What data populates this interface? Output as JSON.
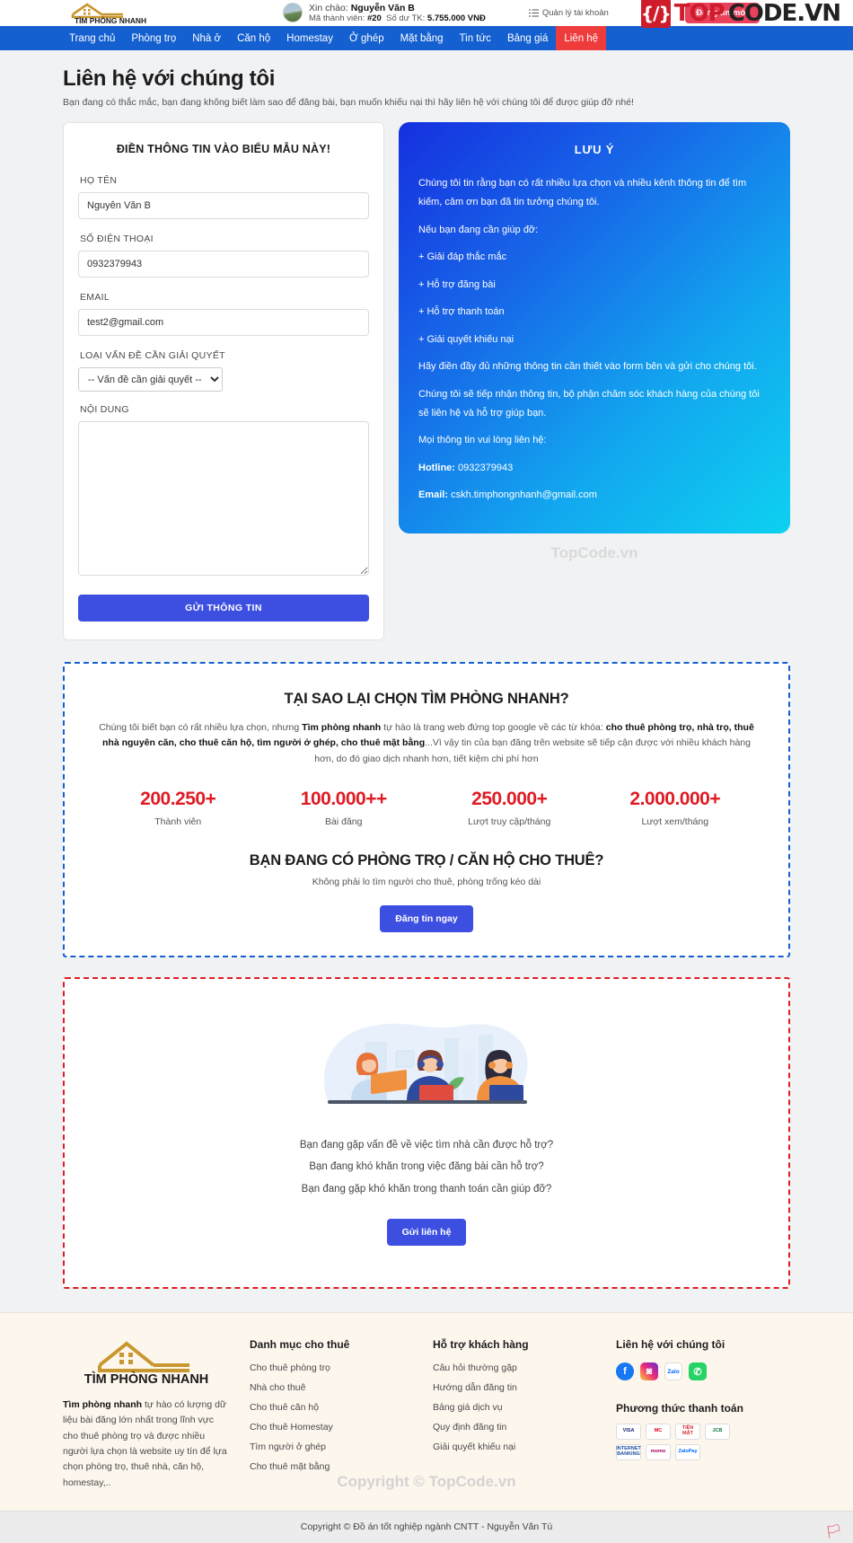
{
  "header": {
    "logo_text": "TÌM PHÒNG NHANH",
    "greeting_label": "Xin chào:",
    "user_name": "Nguyễn Văn B",
    "member_label": "Mã thành viên:",
    "member_id": "#20",
    "balance_label": "Số dư TK:",
    "balance_value": "5.755.000 VNĐ",
    "account_link": "Quản lý tài khoản",
    "account_icon": "list-settings-icon",
    "bell_icon": "notification-bell-icon",
    "post_button": "Đăng tin mới",
    "watermark_badge": "{/}",
    "watermark_top": "TOP",
    "watermark_rest": "CODE.VN"
  },
  "nav": {
    "items": [
      {
        "label": "Trang chủ",
        "active": false
      },
      {
        "label": "Phòng trọ",
        "active": false
      },
      {
        "label": "Nhà ở",
        "active": false
      },
      {
        "label": "Căn hộ",
        "active": false
      },
      {
        "label": "Homestay",
        "active": false
      },
      {
        "label": "Ở ghép",
        "active": false
      },
      {
        "label": "Mặt bằng",
        "active": false
      },
      {
        "label": "Tin tức",
        "active": false
      },
      {
        "label": "Bảng giá",
        "active": false
      },
      {
        "label": "Liên hệ",
        "active": true
      }
    ]
  },
  "page": {
    "title": "Liên hệ với chúng tôi",
    "subtitle": "Bạn đang có thắc mắc, bạn đang không biết làm sao để đăng bài, bạn muốn khiếu nại thì hãy liên hệ với chúng tôi để được giúp đỡ nhé!"
  },
  "form": {
    "heading": "ĐIỀN THÔNG TIN VÀO BIỂU MẪU NÀY!",
    "name_label": "HỌ TÊN",
    "name_value": "Nguyễn Văn B",
    "phone_label": "SỐ ĐIỆN THOẠI",
    "phone_value": "0932379943",
    "email_label": "EMAIL",
    "email_value": "test2@gmail.com",
    "issue_label": "LOẠI VẤN ĐỀ CẦN GIẢI QUYẾT",
    "issue_selected": "-- Vấn đề cần giải quyết --",
    "issue_options": [
      "-- Vấn đề cần giải quyết --"
    ],
    "content_label": "NỘI DUNG",
    "content_value": "",
    "content_placeholder": "",
    "submit_label": "GỬI THÔNG TIN"
  },
  "note": {
    "heading": "LƯU Ý",
    "paragraphs": [
      "Chúng tôi tin rằng bạn có rất nhiều lựa chọn và nhiều kênh thông tin để tìm kiếm, cảm ơn bạn đã tin tưởng chúng tôi.",
      "Nếu bạn đang cần giúp đỡ:",
      "+ Giải đáp thắc mắc",
      "+ Hỗ trợ đăng bài",
      "+ Hỗ trợ thanh toán",
      "+ Giải quyết khiếu nại",
      "Hãy điền đầy đủ những thông tin cần thiết vào form bên và gửi cho chúng tôi.",
      "Chúng tôi sẽ tiếp nhận thông tin, bộ phận chăm sóc khách hàng của chúng tôi sẽ liên hệ và hỗ trợ giúp bạn.",
      "Mọi thông tin vui lòng liên hệ:"
    ],
    "hotline_label": "Hotline:",
    "hotline_value": "0932379943",
    "email_label": "Email:",
    "email_value": "cskh.timphongnhanh@gmail.com",
    "watermark": "TopCode.vn"
  },
  "why": {
    "heading": "TẠI SAO LẠI CHỌN TÌM PHÒNG NHANH?",
    "desc_part1": "Chúng tôi biết bạn có rất nhiều lựa chọn, nhưng ",
    "desc_brand": "Tìm phòng nhanh",
    "desc_part2": " tự hào là trang web đứng top google về các từ khóa: ",
    "desc_keywords": "cho thuê phòng trọ, nhà trọ, thuê nhà nguyên căn, cho thuê căn hộ, tìm người ở ghép, cho thuê mặt bằng",
    "desc_part3": "...Vì vậy tin của bạn đăng trên website sẽ tiếp cận được với nhiều khách hàng hơn, do đó giao dịch nhanh hơn, tiết kiệm chi phí hơn",
    "stats": [
      {
        "value": "200.250+",
        "label": "Thành viên"
      },
      {
        "value": "100.000++",
        "label": "Bài đăng"
      },
      {
        "value": "250.000+",
        "label": "Lượt truy cập/tháng"
      },
      {
        "value": "2.000.000+",
        "label": "Lượt xem/tháng"
      }
    ],
    "cta_heading": "BẠN ĐANG CÓ PHÒNG TRỌ / CĂN HỘ CHO THUÊ?",
    "cta_sub": "Không phải lo tìm người cho thuê, phòng trống kéo dài",
    "cta_button": "Đăng tin ngay"
  },
  "support": {
    "illustration": "customer-support-team-illustration",
    "lines": [
      "Bạn đang gặp vấn đề về việc tìm nhà cần được hỗ trợ?",
      "Bạn đang khó khăn trong việc đăng bài cần hỗ trợ?",
      "Bạn đang gặp khó khăn trong thanh toán cần giúp đỡ?"
    ],
    "button": "Gửi liên hệ"
  },
  "footer": {
    "logo_text": "TÌM PHÒNG NHANH",
    "about_brand": "Tìm phòng nhanh",
    "about_text": " tự hào có lượng dữ liệu bài đăng lớn nhất trong lĩnh vực cho thuê phòng trọ và được nhiều người lựa chọn là website uy tín để lựa chọn phòng trọ, thuê nhà, căn hộ, homestay,..",
    "col_rent_title": "Danh mục cho thuê",
    "col_rent_items": [
      "Cho thuê phòng trọ",
      "Nhà cho thuê",
      "Cho thuê căn hộ",
      "Cho thuê Homestay",
      "Tìm người ở ghép",
      "Cho thuê mặt bằng"
    ],
    "col_support_title": "Hỗ trợ khách hàng",
    "col_support_items": [
      "Câu hỏi thường gặp",
      "Hướng dẫn đăng tin",
      "Bảng giá dịch vụ",
      "Quy định đăng tin",
      "Giải quyết khiếu nại"
    ],
    "col_contact_title": "Liên hệ với chúng tôi",
    "socials": [
      {
        "name": "facebook-icon",
        "glyph": "f"
      },
      {
        "name": "instagram-icon",
        "glyph": "◙"
      },
      {
        "name": "zalo-icon",
        "glyph": "Zalo"
      },
      {
        "name": "phone-icon",
        "glyph": "✆"
      }
    ],
    "payment_title": "Phương thức thanh toán",
    "payments": [
      {
        "name": "visa-card",
        "label": "VISA"
      },
      {
        "name": "mastercard",
        "label": "MC"
      },
      {
        "name": "tien-mat",
        "label": "TIỀN MẶT"
      },
      {
        "name": "jcb-card",
        "label": "JCB"
      },
      {
        "name": "internet-banking",
        "label": "INTERNET BANKING"
      },
      {
        "name": "momo-wallet",
        "label": "momo"
      },
      {
        "name": "zalopay-wallet",
        "label": "ZaloPay"
      }
    ],
    "watermark": "Copyright © TopCode.vn"
  },
  "copyright": {
    "text": "Copyright © Đồ án tốt nghiệp ngành CNTT - Nguyễn Văn Tú"
  }
}
